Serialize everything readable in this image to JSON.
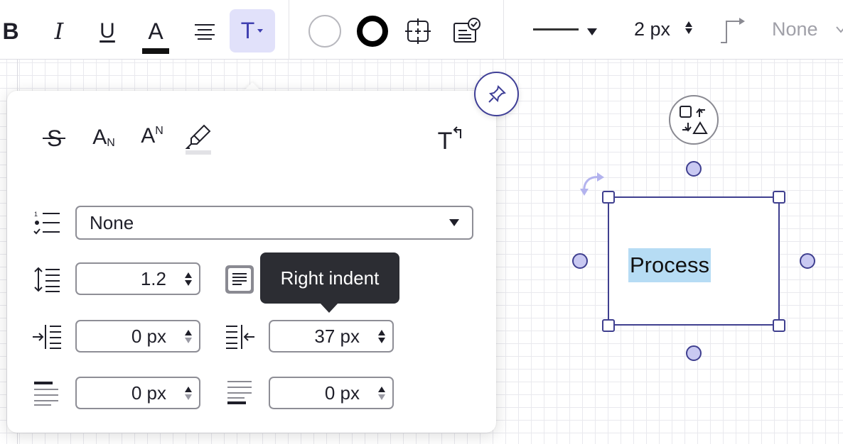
{
  "toolbar": {
    "bold_label": "B",
    "italic_label": "I",
    "underline_label": "U",
    "font_color_label": "A",
    "text_options_label": "T",
    "stroke_width": "2 px",
    "end_arrow_value": "None",
    "font_color": "#111111",
    "fill_color": "#ffffff",
    "stroke_color": "#000000"
  },
  "panel": {
    "subscript_letter": "A",
    "subscript_mark": "N",
    "superscript_letter": "A",
    "superscript_mark": "N",
    "text_reset_label": "T",
    "list_style": {
      "value": "None"
    },
    "line_spacing": {
      "value": "1.2"
    },
    "left_indent": {
      "value": "0 px"
    },
    "right_indent": {
      "value": "37 px"
    },
    "space_before": {
      "value": "0 px"
    },
    "space_after": {
      "value": "0 px"
    },
    "tooltip": "Right indent"
  },
  "canvas": {
    "shape_text": "Process",
    "selection_color": "#3f3f8f",
    "text_highlight_color": "#b6dcf4"
  }
}
